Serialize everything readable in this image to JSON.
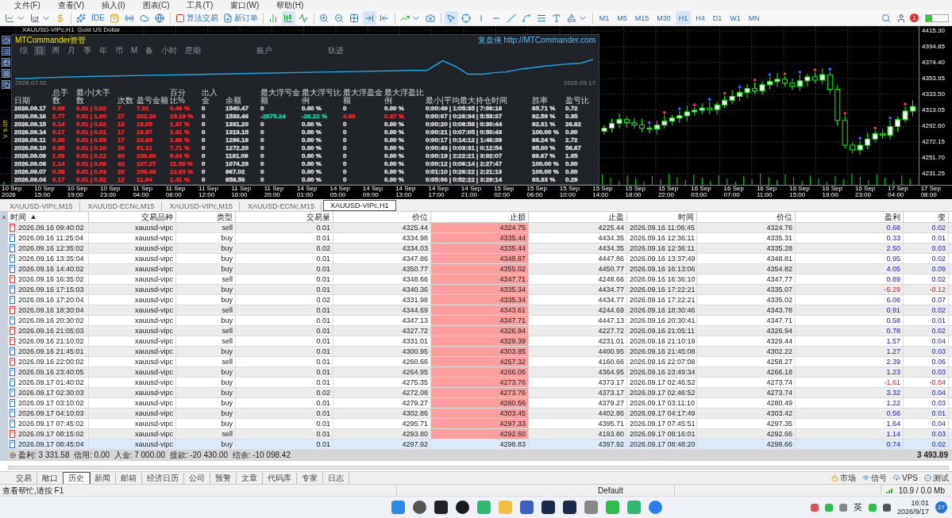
{
  "menu": [
    "文件(F)",
    "查看(V)",
    "插入(I)",
    "图表(C)",
    "工具(T)",
    "窗口(W)",
    "帮助(H)"
  ],
  "toolbar": {
    "ide": "IDE",
    "algo_trading": "算法交易",
    "new_order": "新订单",
    "timeframes": [
      {
        "label": "M1",
        "selected": false
      },
      {
        "label": "M5",
        "selected": false
      },
      {
        "label": "M15",
        "selected": false
      },
      {
        "label": "M30",
        "selected": false
      },
      {
        "label": "H1",
        "selected": true
      },
      {
        "label": "H4",
        "selected": false
      },
      {
        "label": "D1",
        "selected": false
      },
      {
        "label": "W1",
        "selected": false
      },
      {
        "label": "MN",
        "selected": false
      }
    ],
    "notification_count": "1"
  },
  "chart": {
    "title": "XAUUSD-VIPc,H1  Gold US Dollar",
    "version": "V 9.05",
    "time_axis": [
      "10 Sep 2026",
      "10 Sep 15:00",
      "10 Sep 19:00",
      "10 Sep 23:00",
      "11 Sep 04:00",
      "11 Sep 08:00",
      "11 Sep 12:00",
      "11 Sep 16:00",
      "11 Sep 20:00",
      "14 Sep 01:00",
      "14 Sep 05:00",
      "14 Sep 09:00",
      "14 Sep 13:00",
      "14 Sep 17:00",
      "14 Sep 21:00",
      "15 Sep 02:00",
      "15 Sep 06:00",
      "15 Sep 10:00",
      "15 Sep 14:00",
      "15 Sep 18:00",
      "15 Sep 22:00",
      "16 Sep 03:00",
      "16 Sep 07:00",
      "16 Sep 11:00",
      "16 Sep 15:00",
      "16 Sep 19:00",
      "16 Sep 23:00",
      "17 Sep 04:00",
      "17 Sep 08:00"
    ],
    "chart_data": {
      "type": "candlestick",
      "grid": true,
      "ylim": [
        4231.25,
        4415.3
      ],
      "yticks": [
        {
          "value": 4415.3,
          "label": "4415.30"
        },
        {
          "value": 4394.85,
          "label": "4394.85"
        },
        {
          "value": 4374.4,
          "label": "4374.40"
        },
        {
          "value": 4353.95,
          "label": "4353.95"
        },
        {
          "value": 4333.5,
          "label": "4333.50"
        },
        {
          "value": 4313.05,
          "label": "4313.05"
        },
        {
          "value": 4292.6,
          "label": "4292.60"
        },
        {
          "value": 4272.15,
          "label": "4272.15"
        },
        {
          "value": 4251.7,
          "label": "4251.70"
        },
        {
          "value": 4231.25,
          "label": "4231.25"
        }
      ],
      "categories": [
        null,
        null,
        null,
        null,
        null,
        null,
        null,
        null,
        null,
        null,
        null,
        null,
        null,
        null,
        null,
        null,
        null,
        null,
        null,
        null,
        null,
        null,
        null,
        null,
        null,
        null,
        null,
        null,
        null,
        null,
        null,
        null,
        null,
        null,
        null,
        null,
        null,
        null,
        null,
        null,
        null,
        null
      ],
      "ohlc": [
        [
          4286,
          4294,
          4282,
          4290
        ],
        [
          4290,
          4302,
          4285,
          4296
        ],
        [
          4296,
          4309,
          4290,
          4301
        ],
        [
          4301,
          4305,
          4290,
          4297
        ],
        [
          4297,
          4303,
          4290,
          4294
        ],
        [
          4294,
          4302,
          4285,
          4290
        ],
        [
          4290,
          4294,
          4283,
          4289
        ],
        [
          4289,
          4300,
          4282,
          4294
        ],
        [
          4294,
          4307,
          4290,
          4299
        ],
        [
          4299,
          4307,
          4294,
          4303
        ],
        [
          4303,
          4312,
          4297,
          4306
        ],
        [
          4306,
          4319,
          4299,
          4311
        ],
        [
          4311,
          4317,
          4307,
          4313
        ],
        [
          4313,
          4322,
          4308,
          4316
        ],
        [
          4316,
          4324,
          4308,
          4314
        ],
        [
          4314,
          4324,
          4307,
          4320
        ],
        [
          4320,
          4332,
          4316,
          4326
        ],
        [
          4326,
          4339,
          4321,
          4331
        ],
        [
          4331,
          4340,
          4325,
          4336
        ],
        [
          4336,
          4347,
          4329,
          4341
        ],
        [
          4341,
          4349,
          4334,
          4338
        ],
        [
          4338,
          4350,
          4333,
          4346
        ],
        [
          4346,
          4356,
          4340,
          4350
        ],
        [
          4350,
          4361,
          4343,
          4353
        ],
        [
          4353,
          4357,
          4344,
          4348
        ],
        [
          4348,
          4354,
          4339,
          4344
        ],
        [
          4344,
          4359,
          4338,
          4351
        ],
        [
          4351,
          4360,
          4344,
          4356
        ],
        [
          4356,
          4362,
          4348,
          4352
        ],
        [
          4352,
          4367,
          4347,
          4359
        ],
        [
          4359,
          4363,
          4334,
          4340
        ],
        [
          4340,
          4346,
          4293,
          4300
        ],
        [
          4300,
          4306,
          4264,
          4268
        ],
        [
          4268,
          4272,
          4257,
          4262
        ],
        [
          4262,
          4274,
          4256,
          4268
        ],
        [
          4268,
          4284,
          4263,
          4276
        ],
        [
          4276,
          4287,
          4272,
          4283
        ],
        [
          4283,
          4289,
          4276,
          4281
        ],
        [
          4281,
          4300,
          4275,
          4292
        ],
        [
          4292,
          4305,
          4285,
          4301
        ],
        [
          4301,
          4318,
          4297,
          4312
        ],
        [
          4312,
          4326,
          4305,
          4318
        ]
      ]
    }
  },
  "panel": {
    "title": "MTCommander资管",
    "site": "复盘侠 http://MTCommander.com",
    "tabs": [
      {
        "label": "综",
        "selected": false
      },
      {
        "label": "日",
        "selected": true
      },
      {
        "label": "周",
        "selected": false
      },
      {
        "label": "月",
        "selected": false
      },
      {
        "label": "季",
        "selected": false
      },
      {
        "label": "年",
        "selected": false
      },
      {
        "label": "币",
        "selected": false
      },
      {
        "label": "M",
        "selected": false
      },
      {
        "label": "备",
        "selected": false
      },
      {
        "label": "小时",
        "selected": false
      },
      {
        "label": "星期",
        "selected": false
      },
      {
        "label": "账户",
        "selected": false
      },
      {
        "label": "轨迹",
        "selected": false
      }
    ],
    "equity_start": "2026.07.01",
    "equity_end": "2026.09.17",
    "columns": [
      "日期",
      "总手数",
      "最小|大手数",
      "次数",
      "盈亏金额",
      "百分比%",
      "出入金",
      "余额",
      "最大浮亏金额",
      "最大浮亏比例",
      "最大浮盈金额",
      "最大浮盈比例",
      "最小|平均最大持仓时间",
      "胜率",
      "盈亏比"
    ],
    "rows": [
      {
        "cells": [
          {
            "text": "2026.09.17",
            "color": "#d4d4d4"
          },
          {
            "text": "0.08",
            "color": "#e8282e"
          },
          {
            "text": "0.01 | 0.02",
            "color": "#e8282e"
          },
          {
            "text": "7",
            "color": "#e8282e"
          },
          {
            "text": "7.01",
            "color": "#e8282e"
          },
          {
            "text": "0.46 %",
            "color": "#e8282e"
          },
          {
            "text": "0",
            "color": "#d4d4d4"
          },
          {
            "text": "1540.47",
            "color": "#d4d4d4"
          },
          {
            "text": "0",
            "color": "#d4d4d4"
          },
          {
            "text": "0.00 %",
            "color": "#d4d4d4"
          },
          {
            "text": "0",
            "color": "#d4d4d4"
          },
          {
            "text": "0.00 %",
            "color": "#d4d4d4"
          },
          {
            "text": "0:00:49 | 1:05:35 | 7:08:18",
            "color": "#d4d4d4"
          },
          {
            "text": "85.71 %",
            "color": "#d4d4d4"
          },
          {
            "text": "0.72",
            "color": "#d4d4d4"
          }
        ]
      },
      {
        "cells": [
          {
            "text": "2026.09.16",
            "color": "#d4d4d4"
          },
          {
            "text": "2.77",
            "color": "#e8282e"
          },
          {
            "text": "0.01 | 1.00",
            "color": "#e8282e"
          },
          {
            "text": "27",
            "color": "#e8282e"
          },
          {
            "text": "202.26",
            "color": "#e8282e"
          },
          {
            "text": "15.19 %",
            "color": "#e8282e"
          },
          {
            "text": "0",
            "color": "#d4d4d4"
          },
          {
            "text": "1533.46",
            "color": "#d4d4d4"
          },
          {
            "text": "-2675.24",
            "color": "#19c9a0"
          },
          {
            "text": "-26.22 %",
            "color": "#19c9a0"
          },
          {
            "text": "4.93",
            "color": "#e8282e"
          },
          {
            "text": "0.37 %",
            "color": "#e8282e"
          },
          {
            "text": "0:00:07 | 0:26:34 | 5:53:37",
            "color": "#d4d4d4"
          },
          {
            "text": "92.59 %",
            "color": "#d4d4d4"
          },
          {
            "text": "0.35",
            "color": "#d4d4d4"
          }
        ]
      },
      {
        "cells": [
          {
            "text": "2026.09.15",
            "color": "#d4d4d4"
          },
          {
            "text": "0.14",
            "color": "#e8282e"
          },
          {
            "text": "0.01 | 0.02",
            "color": "#e8282e"
          },
          {
            "text": "13",
            "color": "#e8282e"
          },
          {
            "text": "18.05",
            "color": "#e8282e"
          },
          {
            "text": "1.37 %",
            "color": "#e8282e"
          },
          {
            "text": "0",
            "color": "#d4d4d4"
          },
          {
            "text": "1331.20",
            "color": "#d4d4d4"
          },
          {
            "text": "0",
            "color": "#d4d4d4"
          },
          {
            "text": "0.00 %",
            "color": "#d4d4d4"
          },
          {
            "text": "0",
            "color": "#d4d4d4"
          },
          {
            "text": "0.00 %",
            "color": "#d4d4d4"
          },
          {
            "text": "0:00:20 | 0:08:58 | 0:30:44",
            "color": "#d4d4d4"
          },
          {
            "text": "92.31 %",
            "color": "#d4d4d4"
          },
          {
            "text": "26.82",
            "color": "#d4d4d4"
          }
        ]
      },
      {
        "cells": [
          {
            "text": "2026.09.14",
            "color": "#d4d4d4"
          },
          {
            "text": "0.17",
            "color": "#e8282e"
          },
          {
            "text": "0.01 | 0.01",
            "color": "#e8282e"
          },
          {
            "text": "17",
            "color": "#e8282e"
          },
          {
            "text": "16.97",
            "color": "#e8282e"
          },
          {
            "text": "1.31 %",
            "color": "#e8282e"
          },
          {
            "text": "0",
            "color": "#d4d4d4"
          },
          {
            "text": "1313.15",
            "color": "#d4d4d4"
          },
          {
            "text": "0",
            "color": "#d4d4d4"
          },
          {
            "text": "0.00 %",
            "color": "#d4d4d4"
          },
          {
            "text": "0",
            "color": "#d4d4d4"
          },
          {
            "text": "0.00 %",
            "color": "#d4d4d4"
          },
          {
            "text": "0:00:21 | 0:07:05 | 0:50:43",
            "color": "#d4d4d4"
          },
          {
            "text": "100.00 %",
            "color": "#d4d4d4"
          },
          {
            "text": "0.00",
            "color": "#d4d4d4"
          }
        ]
      },
      {
        "cells": [
          {
            "text": "2026.09.11",
            "color": "#d4d4d4"
          },
          {
            "text": "0.36",
            "color": "#e8282e"
          },
          {
            "text": "0.01 | 0.05",
            "color": "#e8282e"
          },
          {
            "text": "17",
            "color": "#e8282e"
          },
          {
            "text": "23.98",
            "color": "#e8282e"
          },
          {
            "text": "1.88 %",
            "color": "#e8282e"
          },
          {
            "text": "0",
            "color": "#d4d4d4"
          },
          {
            "text": "1296.18",
            "color": "#d4d4d4"
          },
          {
            "text": "0",
            "color": "#d4d4d4"
          },
          {
            "text": "0.00 %",
            "color": "#d4d4d4"
          },
          {
            "text": "0",
            "color": "#d4d4d4"
          },
          {
            "text": "0.00 %",
            "color": "#d4d4d4"
          },
          {
            "text": "0:00:17 | 0:14:12 | 1:46:39",
            "color": "#d4d4d4"
          },
          {
            "text": "88.24 %",
            "color": "#d4d4d4"
          },
          {
            "text": "2.72",
            "color": "#d4d4d4"
          }
        ]
      },
      {
        "cells": [
          {
            "text": "2026.09.10",
            "color": "#d4d4d4"
          },
          {
            "text": "0.85",
            "color": "#e8282e"
          },
          {
            "text": "0.01 | 0.10",
            "color": "#e8282e"
          },
          {
            "text": "20",
            "color": "#e8282e"
          },
          {
            "text": "91.11",
            "color": "#e8282e"
          },
          {
            "text": "7.71 %",
            "color": "#e8282e"
          },
          {
            "text": "0",
            "color": "#d4d4d4"
          },
          {
            "text": "1272.20",
            "color": "#d4d4d4"
          },
          {
            "text": "0",
            "color": "#d4d4d4"
          },
          {
            "text": "0.00 %",
            "color": "#d4d4d4"
          },
          {
            "text": "0",
            "color": "#d4d4d4"
          },
          {
            "text": "0.00 %",
            "color": "#d4d4d4"
          },
          {
            "text": "0:00:43 | 0:03:31 | 0:12:54",
            "color": "#d4d4d4"
          },
          {
            "text": "95.00 %",
            "color": "#d4d4d4"
          },
          {
            "text": "56.87",
            "color": "#d4d4d4"
          }
        ]
      },
      {
        "cells": [
          {
            "text": "2026.09.09",
            "color": "#d4d4d4"
          },
          {
            "text": "1.03",
            "color": "#e8282e"
          },
          {
            "text": "0.01 | 0.12",
            "color": "#e8282e"
          },
          {
            "text": "30",
            "color": "#e8282e"
          },
          {
            "text": "106.80",
            "color": "#e8282e"
          },
          {
            "text": "9.94 %",
            "color": "#e8282e"
          },
          {
            "text": "0",
            "color": "#d4d4d4"
          },
          {
            "text": "1181.09",
            "color": "#d4d4d4"
          },
          {
            "text": "0",
            "color": "#d4d4d4"
          },
          {
            "text": "0.00 %",
            "color": "#d4d4d4"
          },
          {
            "text": "0",
            "color": "#d4d4d4"
          },
          {
            "text": "0.00 %",
            "color": "#d4d4d4"
          },
          {
            "text": "0:00:19 | 2:22:21 | 3:02:07",
            "color": "#d4d4d4"
          },
          {
            "text": "86.67 %",
            "color": "#d4d4d4"
          },
          {
            "text": "1.05",
            "color": "#d4d4d4"
          }
        ]
      },
      {
        "cells": [
          {
            "text": "2026.09.08",
            "color": "#d4d4d4"
          },
          {
            "text": "1.14",
            "color": "#e8282e"
          },
          {
            "text": "0.01 | 0.06",
            "color": "#e8282e"
          },
          {
            "text": "42",
            "color": "#e8282e"
          },
          {
            "text": "107.27",
            "color": "#e8282e"
          },
          {
            "text": "11.09 %",
            "color": "#e8282e"
          },
          {
            "text": "0",
            "color": "#d4d4d4"
          },
          {
            "text": "1074.29",
            "color": "#d4d4d4"
          },
          {
            "text": "0",
            "color": "#d4d4d4"
          },
          {
            "text": "0.00 %",
            "color": "#d4d4d4"
          },
          {
            "text": "0",
            "color": "#d4d4d4"
          },
          {
            "text": "0.00 %",
            "color": "#d4d4d4"
          },
          {
            "text": "0:00:12 | 0:06:14 | 2:27:47",
            "color": "#d4d4d4"
          },
          {
            "text": "100.00 %",
            "color": "#d4d4d4"
          },
          {
            "text": "0.00",
            "color": "#d4d4d4"
          }
        ]
      },
      {
        "cells": [
          {
            "text": "2026.09.07",
            "color": "#d4d4d4"
          },
          {
            "text": "0.38",
            "color": "#e8282e"
          },
          {
            "text": "0.01 | 0.03",
            "color": "#e8282e"
          },
          {
            "text": "28",
            "color": "#e8282e"
          },
          {
            "text": "108.46",
            "color": "#e8282e"
          },
          {
            "text": "12.63 %",
            "color": "#e8282e"
          },
          {
            "text": "0",
            "color": "#d4d4d4"
          },
          {
            "text": "967.02",
            "color": "#d4d4d4"
          },
          {
            "text": "0",
            "color": "#d4d4d4"
          },
          {
            "text": "0.00 %",
            "color": "#d4d4d4"
          },
          {
            "text": "0",
            "color": "#d4d4d4"
          },
          {
            "text": "0.00 %",
            "color": "#d4d4d4"
          },
          {
            "text": "0:01:10 | 0:26:22 | 2:21:13",
            "color": "#d4d4d4"
          },
          {
            "text": "100.00 %",
            "color": "#d4d4d4"
          },
          {
            "text": "0.00",
            "color": "#d4d4d4"
          }
        ]
      },
      {
        "cells": [
          {
            "text": "2026.09.04",
            "color": "#d4d4d4"
          },
          {
            "text": "0.17",
            "color": "#e8282e"
          },
          {
            "text": "0.01 | 0.02",
            "color": "#e8282e"
          },
          {
            "text": "12",
            "color": "#e8282e"
          },
          {
            "text": "11.94",
            "color": "#e8282e"
          },
          {
            "text": "1.41 %",
            "color": "#e8282e"
          },
          {
            "text": "0",
            "color": "#d4d4d4"
          },
          {
            "text": "858.56",
            "color": "#d4d4d4"
          },
          {
            "text": "0",
            "color": "#d4d4d4"
          },
          {
            "text": "0.00 %",
            "color": "#d4d4d4"
          },
          {
            "text": "0",
            "color": "#d4d4d4"
          },
          {
            "text": "0.00 %",
            "color": "#d4d4d4"
          },
          {
            "text": "0:05:06 | 0:52:22 | 3:29:14",
            "color": "#d4d4d4"
          },
          {
            "text": "83.33 %",
            "color": "#d4d4d4"
          },
          {
            "text": "0.29",
            "color": "#d4d4d4"
          }
        ]
      }
    ]
  },
  "chart_tabs": [
    {
      "label": "XAUUSD-VIPc,M15",
      "selected": false
    },
    {
      "label": "XAUUSD-ECNc,M15",
      "selected": false
    },
    {
      "label": "XAUUSD-VIPc,M15",
      "selected": false
    },
    {
      "label": "XAUUSD-ECNc,M15",
      "selected": false
    },
    {
      "label": "XAUUSD-VIPc,H1",
      "selected": true
    }
  ],
  "history": {
    "columns": [
      {
        "label": "时间",
        "sorted": true
      },
      {
        "label": "交易品种",
        "sorted": false
      },
      {
        "label": "类型",
        "sorted": false
      },
      {
        "label": "交易量",
        "sorted": false
      },
      {
        "label": "价位",
        "sorted": false
      },
      {
        "label": "止损",
        "sorted": false
      },
      {
        "label": "止盈",
        "sorted": false
      },
      {
        "label": "时间",
        "sorted": false
      },
      {
        "label": "价位",
        "sorted": false
      },
      {
        "label": "盈利",
        "sorted": false
      },
      {
        "label": "变",
        "sorted": false
      }
    ],
    "rows": [
      {
        "kind": "sell",
        "loss": false,
        "selected": false,
        "cells": [
          "2026.09.16 09:40:02",
          "xauusd-vipc",
          "sell",
          "0.01",
          "4325.44",
          "4324.75",
          "4225.44",
          "2026.09.16 11:06:45",
          "4324.76",
          "0.68",
          "0.02"
        ]
      },
      {
        "kind": "buy",
        "loss": false,
        "selected": false,
        "cells": [
          "2026.09.16 11:25:04",
          "xauusd-vipc",
          "buy",
          "0.01",
          "4334.98",
          "4335.44",
          "4434.35",
          "2026.09.16 12:36:11",
          "4335.31",
          "0.33",
          "0.01"
        ]
      },
      {
        "kind": "buy",
        "loss": false,
        "selected": false,
        "cells": [
          "2026.09.16 12:35:02",
          "xauusd-vipc",
          "buy",
          "0.02",
          "4334.03",
          "4335.44",
          "4434.35",
          "2026.09.16 12:36:11",
          "4335.28",
          "2.50",
          "0.03"
        ]
      },
      {
        "kind": "buy",
        "loss": false,
        "selected": false,
        "cells": [
          "2026.09.16 13:35:04",
          "xauusd-vipc",
          "buy",
          "0.01",
          "4347.86",
          "4348.87",
          "4447.86",
          "2026.09.16 13:37:49",
          "4348.81",
          "0.95",
          "0.02"
        ]
      },
      {
        "kind": "buy",
        "loss": false,
        "selected": false,
        "cells": [
          "2026.09.16 14:40:02",
          "xauusd-vipc",
          "buy",
          "0.01",
          "4350.77",
          "4355.02",
          "4450.77",
          "2026.09.16 16:13:06",
          "4354.82",
          "4.05",
          "0.09"
        ]
      },
      {
        "kind": "sell",
        "loss": false,
        "selected": false,
        "cells": [
          "2026.09.16 16:35:02",
          "xauusd-vipc",
          "sell",
          "0.01",
          "4348.66",
          "4347.71",
          "4248.66",
          "2026.09.16 16:36:10",
          "4347.77",
          "0.89",
          "0.02"
        ]
      },
      {
        "kind": "buy",
        "loss": true,
        "selected": false,
        "cells": [
          "2026.09.16 17:15:03",
          "xauusd-vipc",
          "buy",
          "0.01",
          "4340.36",
          "4335.34",
          "4434.77",
          "2026.09.16 17:22:21",
          "4335.07",
          "-5.29",
          "-0.12"
        ]
      },
      {
        "kind": "buy",
        "loss": false,
        "selected": false,
        "cells": [
          "2026.09.16 17:20:04",
          "xauusd-vipc",
          "buy",
          "0.02",
          "4331.98",
          "4335.34",
          "4434.77",
          "2026.09.16 17:22:21",
          "4335.02",
          "6.08",
          "0.07"
        ]
      },
      {
        "kind": "sell",
        "loss": false,
        "selected": false,
        "cells": [
          "2026.09.16 18:30:04",
          "xauusd-vipc",
          "sell",
          "0.01",
          "4344.69",
          "4343.61",
          "4244.69",
          "2026.09.16 18:30:46",
          "4343.78",
          "0.91",
          "0.02"
        ]
      },
      {
        "kind": "buy",
        "loss": false,
        "selected": false,
        "cells": [
          "2026.09.16 20:30:02",
          "xauusd-vipc",
          "buy",
          "0.01",
          "4347.13",
          "4347.71",
          "4447.13",
          "2026.09.16 20:30:41",
          "4347.71",
          "0.58",
          "0.01"
        ]
      },
      {
        "kind": "sell",
        "loss": false,
        "selected": false,
        "cells": [
          "2026.09.16 21:05:03",
          "xauusd-vipc",
          "sell",
          "0.01",
          "4327.72",
          "4326.94",
          "4227.72",
          "2026.09.16 21:05:11",
          "4326.94",
          "0.78",
          "0.02"
        ]
      },
      {
        "kind": "sell",
        "loss": false,
        "selected": false,
        "cells": [
          "2026.09.16 21:10:02",
          "xauusd-vipc",
          "sell",
          "0.01",
          "4331.01",
          "4329.39",
          "4231.01",
          "2026.09.16 21:10:19",
          "4329.44",
          "1.57",
          "0.04"
        ]
      },
      {
        "kind": "buy",
        "loss": false,
        "selected": false,
        "cells": [
          "2026.09.16 21:45:01",
          "xauusd-vipc",
          "buy",
          "0.01",
          "4300.95",
          "4303.85",
          "4400.95",
          "2026.09.16 21:45:08",
          "4302.22",
          "1.27",
          "0.03"
        ]
      },
      {
        "kind": "sell",
        "loss": false,
        "selected": false,
        "cells": [
          "2026.09.16 22:00:02",
          "xauusd-vipc",
          "sell",
          "0.01",
          "4260.66",
          "4257.32",
          "4160.66",
          "2026.09.16 22:07:08",
          "4258.27",
          "2.39",
          "0.06"
        ]
      },
      {
        "kind": "buy",
        "loss": false,
        "selected": false,
        "cells": [
          "2026.09.16 23:40:05",
          "xauusd-vipc",
          "buy",
          "0.01",
          "4264.95",
          "4266.06",
          "4364.95",
          "2026.09.16 23:49:34",
          "4266.18",
          "1.23",
          "0.03"
        ]
      },
      {
        "kind": "buy",
        "loss": true,
        "selected": false,
        "cells": [
          "2026.09.17 01:40:02",
          "xauusd-vipc",
          "buy",
          "0.01",
          "4275.35",
          "4273.76",
          "4373.17",
          "2026.09.17 02:46:52",
          "4273.74",
          "-1.61",
          "-0.04"
        ]
      },
      {
        "kind": "buy",
        "loss": false,
        "selected": false,
        "cells": [
          "2026.09.17 02:30:03",
          "xauusd-vipc",
          "buy",
          "0.02",
          "4272.08",
          "4273.76",
          "4373.17",
          "2026.09.17 02:46:52",
          "4273.74",
          "3.32",
          "0.04"
        ]
      },
      {
        "kind": "buy",
        "loss": false,
        "selected": false,
        "cells": [
          "2026.09.17 03:10:02",
          "xauusd-vipc",
          "buy",
          "0.01",
          "4279.27",
          "4280.56",
          "4379.27",
          "2026.09.17 03:11:10",
          "4280.49",
          "1.22",
          "0.03"
        ]
      },
      {
        "kind": "buy",
        "loss": false,
        "selected": false,
        "cells": [
          "2026.09.17 04:10:03",
          "xauusd-vipc",
          "buy",
          "0.01",
          "4302.86",
          "4303.45",
          "4402.86",
          "2026.09.17 04:17:49",
          "4303.42",
          "0.56",
          "0.01"
        ]
      },
      {
        "kind": "buy",
        "loss": false,
        "selected": false,
        "cells": [
          "2026.09.17 07:45:02",
          "xauusd-vipc",
          "buy",
          "0.01",
          "4295.71",
          "4297.33",
          "4395.71",
          "2026.09.17 07:45:51",
          "4297.35",
          "1.64",
          "0.04"
        ]
      },
      {
        "kind": "sell",
        "loss": false,
        "selected": false,
        "cells": [
          "2026.09.17 08:15:02",
          "xauusd-vipc",
          "sell",
          "0.01",
          "4293.80",
          "4292.60",
          "4193.80",
          "2026.09.17 08:16:01",
          "4292.66",
          "1.14",
          "0.03"
        ]
      },
      {
        "kind": "buy",
        "loss": false,
        "selected": true,
        "cells": [
          "2026.09.17 08:45:04",
          "xauusd-vipc",
          "buy",
          "0.01",
          "4297.92",
          "4298.83",
          "4397.92",
          "2026.09.17 08:48:20",
          "4298.66",
          "0.74",
          "0.02"
        ]
      }
    ],
    "summary": "盈利: 3 331.58  信用: 0.00  入金: 7 000.00  提款: -20 430.00  结余: -10 098.42",
    "total": "3 493.89"
  },
  "terminal_tabs": [
    {
      "label": "交易",
      "selected": false
    },
    {
      "label": "敞口",
      "selected": false
    },
    {
      "label": "历史",
      "selected": true
    },
    {
      "label": "新闻",
      "selected": false
    },
    {
      "label": "邮箱",
      "selected": false
    },
    {
      "label": "经济日历",
      "selected": false
    },
    {
      "label": "公司",
      "selected": false
    },
    {
      "label": "预警",
      "selected": false
    },
    {
      "label": "文章",
      "selected": false
    },
    {
      "label": "代码库",
      "selected": false
    },
    {
      "label": "专家",
      "selected": false
    },
    {
      "label": "日志",
      "selected": false
    }
  ],
  "terminal_links": [
    "市场",
    "信号",
    "VPS",
    "测试"
  ],
  "status_bar": {
    "help": "查看帮忙,请按 F1",
    "profile": "Default",
    "traffic": "10.9 / 0.0 Mb"
  },
  "taskbar": {
    "input_method": "英",
    "time": "16:01",
    "date": "2026/9/17",
    "notification_count": "27"
  }
}
